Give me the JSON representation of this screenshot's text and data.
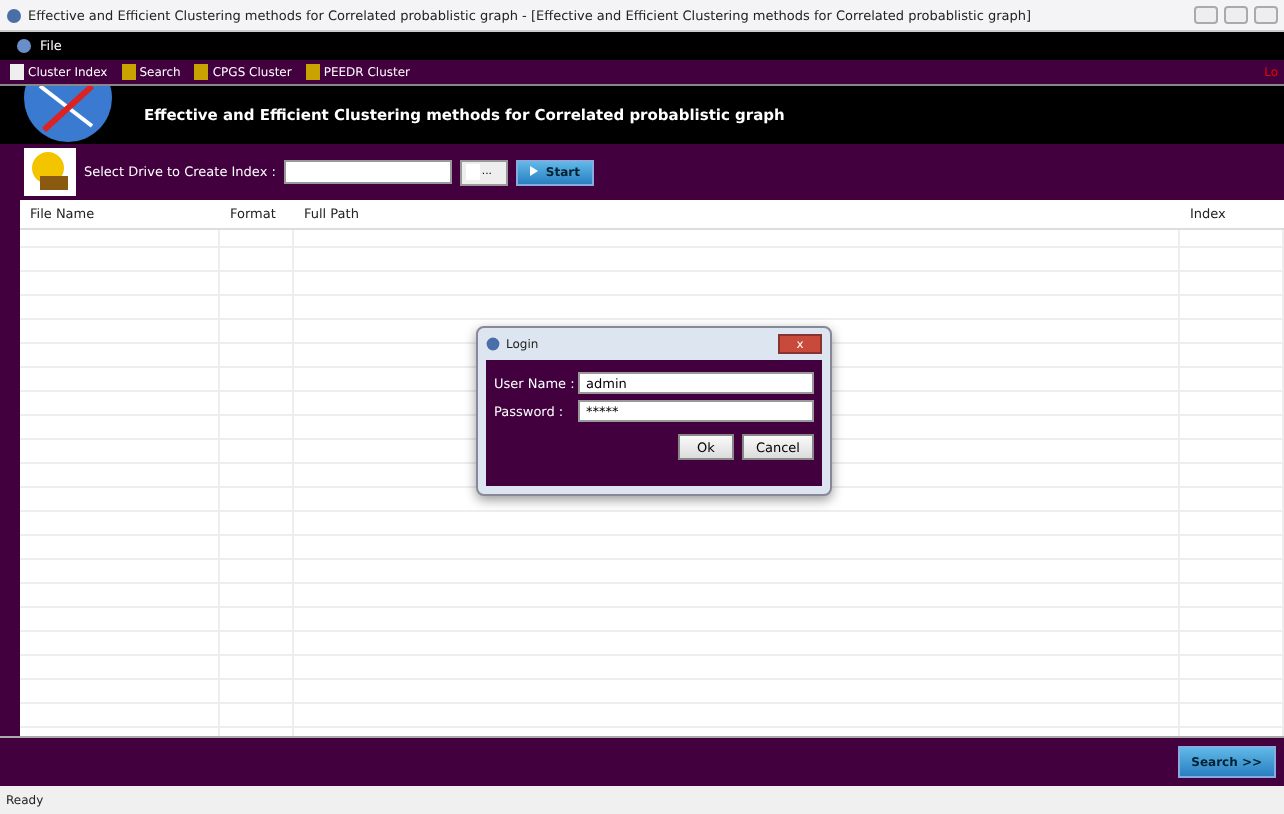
{
  "window": {
    "title": "Effective and Efficient Clustering methods for Correlated probablistic graph - [Effective and Efficient Clustering methods for Correlated probablistic graph]"
  },
  "menu": [
    "File"
  ],
  "toolbar": {
    "items": [
      "Cluster Index",
      "Search",
      "CPGS Cluster",
      "PEEDR Cluster"
    ],
    "right_text": "Lo"
  },
  "banner": {
    "title": "Effective and Efficient Clustering methods for Correlated probablistic graph"
  },
  "index_bar": {
    "label": "Select Drive to Create Index :",
    "browse": "...",
    "start": "Start"
  },
  "table": {
    "columns": [
      "File Name",
      "Format",
      "Full Path",
      "Index"
    ]
  },
  "dialog": {
    "title": "Login",
    "close": "x",
    "fields": [
      {
        "label": "User Name :",
        "value": "admin"
      },
      {
        "label": "Password :",
        "value": "*****"
      }
    ],
    "buttons": [
      "Ok",
      "Cancel"
    ]
  },
  "search_button": "Search >>",
  "status_bar": "Ready"
}
